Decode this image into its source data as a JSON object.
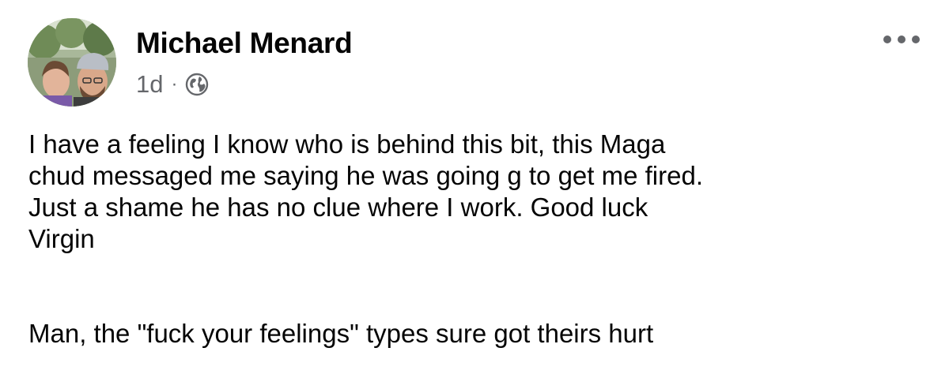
{
  "post": {
    "author": "Michael Menard",
    "time": "1d",
    "separator": "·",
    "privacy_icon": "globe-icon",
    "more_icon": "more-options-icon",
    "paragraphs": [
      "I have a feeling I know who is behind this bit, this Maga\nchud messaged me saying he was going g to get me fired.\nJust a shame he has no clue where I work. Good luck\nVirgin",
      "Man, the \"fuck your feelings\" types sure got theirs hurt"
    ]
  },
  "colors": {
    "text": "#050505",
    "secondary_text": "#65676b",
    "background": "#ffffff"
  }
}
